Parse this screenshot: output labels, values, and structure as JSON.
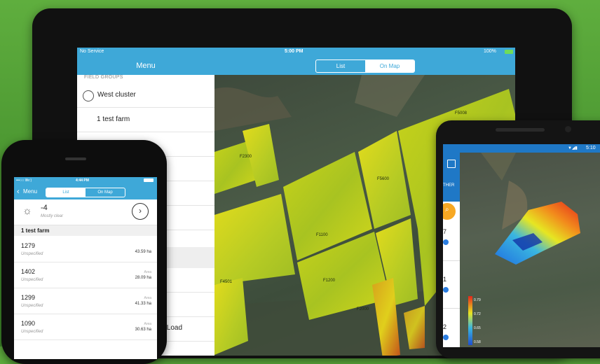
{
  "tablet": {
    "status": {
      "carrier": "No Service",
      "time": "5:00 PM",
      "battery": "100%"
    },
    "nav": {
      "menu_title": "Menu",
      "tabs": [
        {
          "label": "List"
        },
        {
          "label": "On Map"
        }
      ],
      "active_tab": "On Map"
    },
    "sidebar": {
      "section_header": "FIELD GROUPS",
      "group_name": "West cluster",
      "farm_name": "1 test farm",
      "partial_item": "s Load"
    },
    "map": {
      "field_labels": [
        "F2300",
        "F1100",
        "F5600",
        "F4501",
        "F1200",
        "F2000",
        "F5008"
      ]
    }
  },
  "iphone": {
    "status": {
      "carrier": "•••○○ life:)",
      "time": "4:44 PM"
    },
    "nav": {
      "back_label": "Menu",
      "tabs": [
        {
          "label": "List"
        },
        {
          "label": "On Map"
        }
      ],
      "active_tab": "List"
    },
    "weather": {
      "temp": "-4",
      "condition": "Mostly clear"
    },
    "farm_header": "1 test farm",
    "fields": [
      {
        "name": "1279",
        "crop": "Unspecified",
        "area_label": "",
        "area": "43.59 ha"
      },
      {
        "name": "1402",
        "crop": "Unspecified",
        "area_label": "Area",
        "area": "28.09 ha"
      },
      {
        "name": "1299",
        "crop": "Unspecified",
        "area_label": "Area",
        "area": "41.33 ha"
      },
      {
        "name": "1090",
        "crop": "Unspecified",
        "area_label": "Area",
        "area": "30.63 ha"
      }
    ]
  },
  "android": {
    "status": {
      "time": "5:10"
    },
    "side_label": "THER",
    "list_numbers": [
      "7",
      "1",
      "2"
    ],
    "scale_values": [
      "0.79",
      "0.72",
      "0.65",
      "0.58"
    ]
  },
  "colors": {
    "accent": "#3ea8d8",
    "android_accent": "#1f78c6",
    "background": "#4e9a33"
  }
}
